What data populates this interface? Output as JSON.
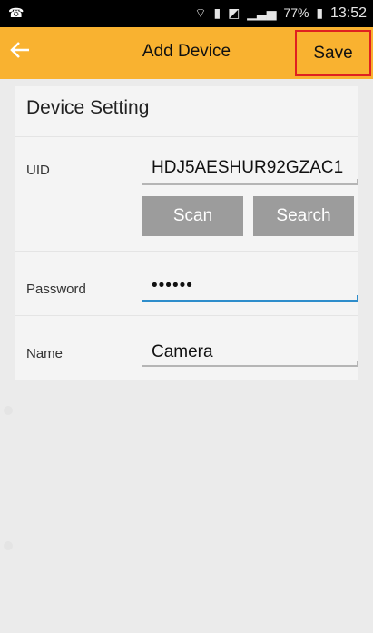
{
  "status": {
    "battery": "77%",
    "time": "13:52"
  },
  "app_bar": {
    "back_icon": "back-arrow-icon",
    "title": "Add Device",
    "save_label": "Save"
  },
  "settings": {
    "section_title": "Device Setting",
    "uid_label": "UID",
    "uid_value": "HDJ5AESHUR92GZAC1",
    "scan_label": "Scan",
    "search_label": "Search",
    "password_label": "Password",
    "password_value": "••••••",
    "name_label": "Name",
    "name_value": "Camera"
  },
  "colors": {
    "app_bar": "#f9b230",
    "button": "#9c9c9c",
    "focus": "#2e8dcb",
    "highlight": "#e02020"
  }
}
